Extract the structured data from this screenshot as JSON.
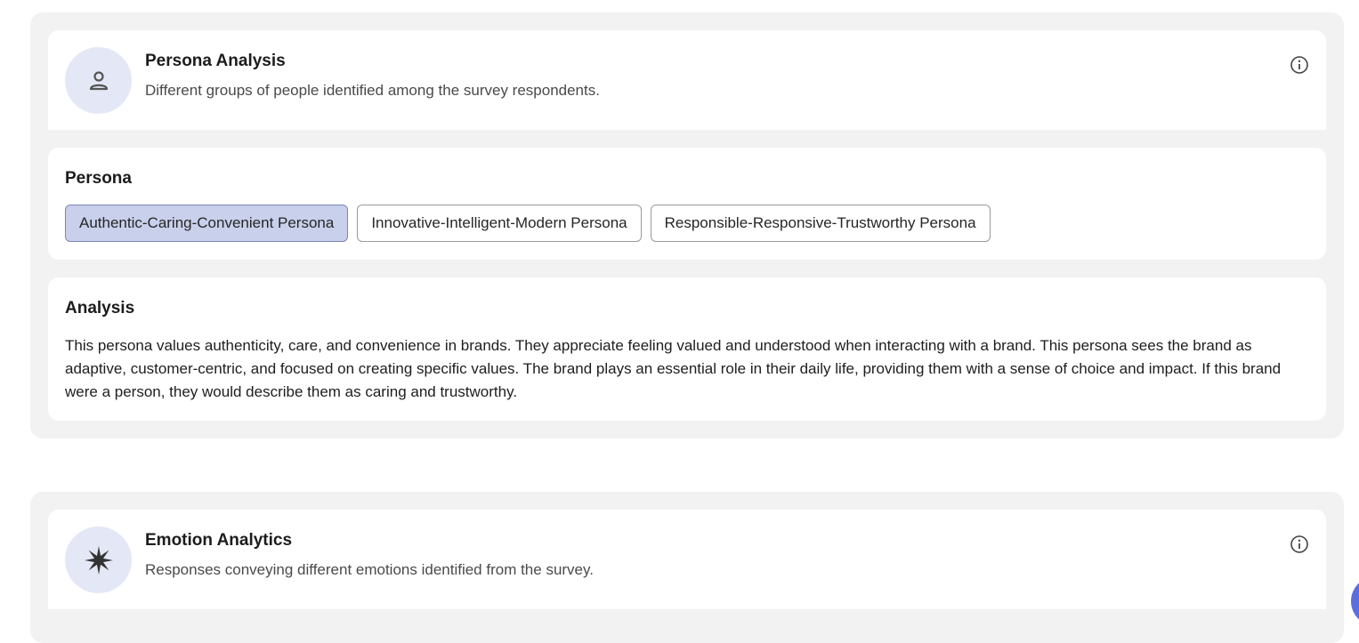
{
  "persona_section": {
    "title": "Persona Analysis",
    "subtitle": "Different groups of people identified among the survey respondents.",
    "icon": "person-icon",
    "info_icon": "info-icon",
    "persona_card": {
      "label": "Persona",
      "options": [
        "Authentic-Caring-Convenient Persona",
        "Innovative-Intelligent-Modern Persona",
        "Responsible-Responsive-Trustworthy Persona"
      ],
      "selected": "Authentic-Caring-Convenient Persona"
    },
    "analysis_card": {
      "label": "Analysis",
      "text": "This persona values authenticity, care, and convenience in brands. They appreciate feeling valued and understood when interacting with a brand. This persona sees the brand as adaptive, customer-centric, and focused on creating specific values. The brand plays an essential role in their daily life, providing them with a sense of choice and impact. If this brand were a person, they would describe them as caring and trustworthy."
    }
  },
  "emotion_section": {
    "title": "Emotion Analytics",
    "subtitle": "Responses conveying different emotions identified from the survey.",
    "icon": "starburst-icon",
    "info_icon": "info-icon"
  },
  "colors": {
    "section_bg": "#f2f2f2",
    "card_bg": "#ffffff",
    "avatar_bg": "#e4e7f5",
    "chip_selected_bg": "#c9d0ec",
    "fab": "#5b6ee0"
  }
}
